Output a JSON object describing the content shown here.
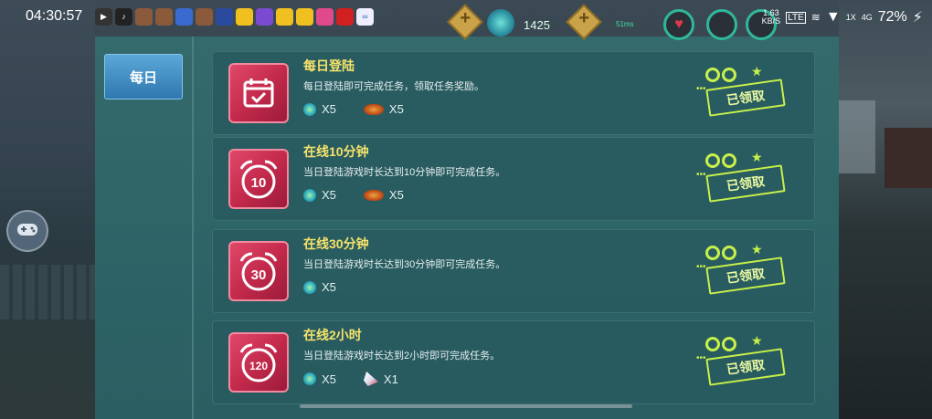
{
  "status_bar": {
    "time": "04:30:57",
    "net_speed_value": "1.63",
    "net_speed_unit": "KB/S",
    "signal_label_1": "1X",
    "signal_label_2": "4G",
    "battery": "72%"
  },
  "hud": {
    "currency_count": "1425",
    "ping_label": "51ms"
  },
  "sidebar": {
    "tab_daily": "每日"
  },
  "tasks": [
    {
      "title": "每日登陆",
      "description": "每日登陆即可完成任务，领取任务奖励。",
      "icon": "calendar-check-icon",
      "rewards": [
        {
          "icon": "gem-icon",
          "amount": "X5"
        },
        {
          "icon": "food-icon",
          "amount": "X5"
        }
      ],
      "status": "已领取"
    },
    {
      "title": "在线10分钟",
      "description": "当日登陆游戏时长达到10分钟即可完成任务。",
      "icon": "alarm-clock-icon",
      "icon_number": "10",
      "rewards": [
        {
          "icon": "gem-icon",
          "amount": "X5"
        },
        {
          "icon": "food-icon",
          "amount": "X5"
        }
      ],
      "status": "已领取"
    },
    {
      "title": "在线30分钟",
      "description": "当日登陆游戏时长达到30分钟即可完成任务。",
      "icon": "alarm-clock-icon",
      "icon_number": "30",
      "rewards": [
        {
          "icon": "gem-icon",
          "amount": "X5"
        }
      ],
      "status": "已领取"
    },
    {
      "title": "在线2小时",
      "description": "当日登陆游戏时长达到2小时即可完成任务。",
      "icon": "alarm-clock-icon",
      "icon_number": "120",
      "rewards": [
        {
          "icon": "gem-icon",
          "amount": "X5"
        },
        {
          "icon": "flag-icon",
          "amount": "X1"
        }
      ],
      "status": "已领取"
    }
  ],
  "colors": {
    "panel_bg": "#2e6668",
    "title_yellow": "#f6e36a",
    "tab_blue": "#2f78b0",
    "stamp_green": "#c8f04a",
    "task_icon_red": "#c42a4c"
  }
}
